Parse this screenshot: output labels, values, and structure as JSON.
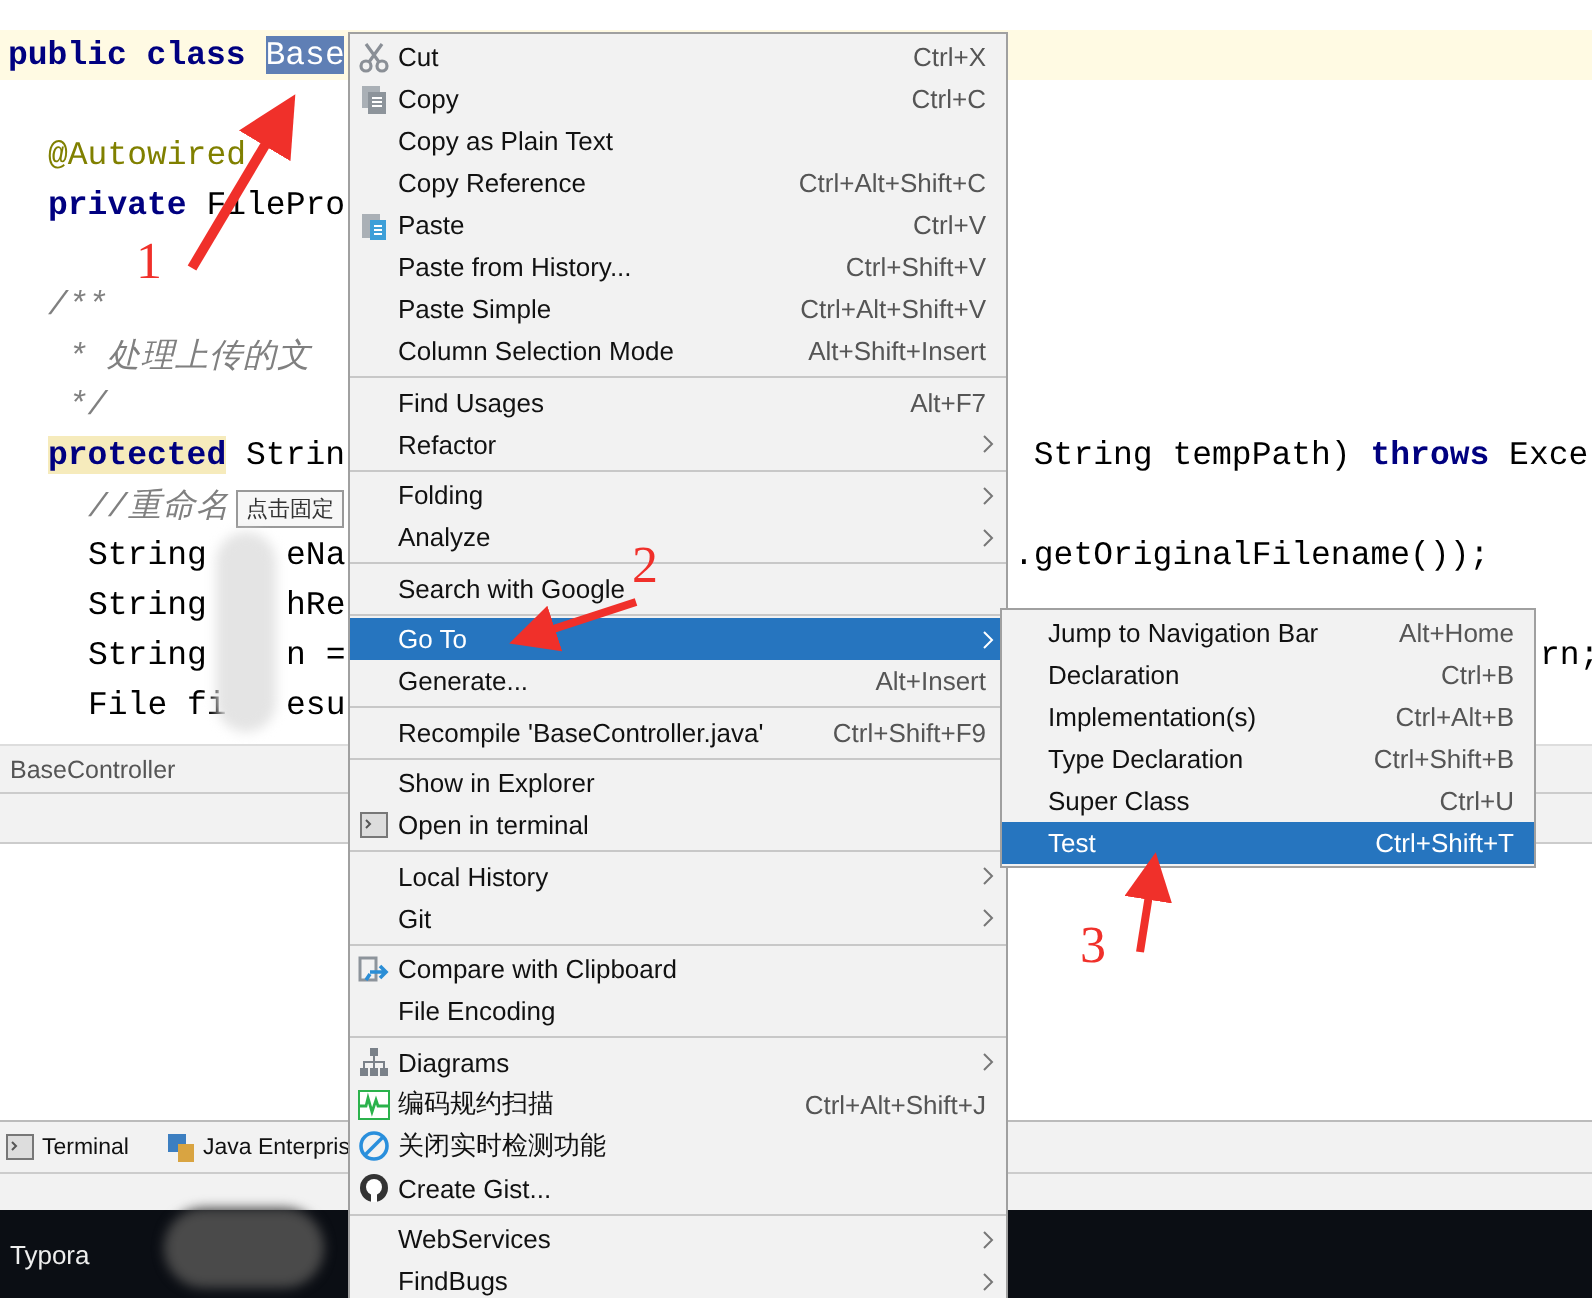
{
  "editor": {
    "lines": [
      {
        "kind": "top",
        "caret_row": true,
        "left": [
          {
            "text": "public class ",
            "kind": "keyword"
          },
          {
            "text": "Base",
            "kind": "selected"
          }
        ]
      },
      {
        "kind": "member"
      },
      {
        "kind": "member",
        "left": [
          {
            "text": "@Autowired",
            "kind": "annotation"
          }
        ]
      },
      {
        "kind": "member",
        "left": [
          {
            "text": "private ",
            "kind": "keyword"
          },
          {
            "text": "FilePro",
            "kind": "plain"
          }
        ]
      },
      {
        "kind": "member"
      },
      {
        "kind": "member",
        "left": [
          {
            "text": "/**",
            "kind": "comment"
          }
        ]
      },
      {
        "kind": "member",
        "left": [
          {
            "text": " * 处理上传的文",
            "kind": "comment"
          }
        ]
      },
      {
        "kind": "member",
        "left": [
          {
            "text": " */",
            "kind": "comment"
          }
        ]
      },
      {
        "kind": "member",
        "left": [
          {
            "text": "protected",
            "kind": "marked"
          },
          {
            "text": " Strin",
            "kind": "plain"
          }
        ],
        "right": [
          {
            "text": " String tempPath) ",
            "kind": "plain"
          },
          {
            "text": "throws",
            "kind": "keyword"
          },
          {
            "text": " Exce",
            "kind": "plain"
          }
        ]
      },
      {
        "kind": "body",
        "left": [
          {
            "text": "//重命名",
            "kind": "comment"
          }
        ]
      },
      {
        "kind": "body",
        "left": [
          {
            "text": "String    eNa",
            "kind": "plain"
          }
        ],
        "right": [
          {
            "text": ".getOriginalFilename());",
            "kind": "plain"
          }
        ]
      },
      {
        "kind": "body",
        "left": [
          {
            "text": "String    hRe",
            "kind": "plain"
          }
        ]
      },
      {
        "kind": "body",
        "left": [
          {
            "text": "String    n =",
            "kind": "plain"
          }
        ],
        "right": [
          {
            "text": "rn;",
            "kind": "tail"
          }
        ]
      },
      {
        "kind": "body",
        "left": [
          {
            "text": "File fi   esu",
            "kind": "plain"
          }
        ]
      }
    ],
    "tooltip": "点击固定"
  },
  "tab": {
    "label": "BaseController"
  },
  "tool_windows": [
    {
      "label": "Terminal",
      "kind": "terminal"
    },
    {
      "label": "Java Enterpris",
      "kind": "enterprise"
    }
  ],
  "taskbar": {
    "label": "Typora"
  },
  "context_menu": [
    {
      "kind": "item",
      "label": "Cut",
      "shortcut": "Ctrl+X",
      "submenu": false,
      "selected": false
    },
    {
      "kind": "item",
      "label": "Copy",
      "shortcut": "Ctrl+C",
      "submenu": false,
      "selected": false
    },
    {
      "kind": "item",
      "label": "Copy as Plain Text",
      "submenu": false,
      "selected": false
    },
    {
      "kind": "item",
      "label": "Copy Reference",
      "shortcut": "Ctrl+Alt+Shift+C",
      "submenu": false,
      "selected": false
    },
    {
      "kind": "item",
      "label": "Paste",
      "shortcut": "Ctrl+V",
      "submenu": false,
      "selected": false
    },
    {
      "kind": "item",
      "label": "Paste from History...",
      "shortcut": "Ctrl+Shift+V",
      "submenu": false,
      "selected": false
    },
    {
      "kind": "item",
      "label": "Paste Simple",
      "shortcut": "Ctrl+Alt+Shift+V",
      "submenu": false,
      "selected": false
    },
    {
      "kind": "item",
      "label": "Column Selection Mode",
      "shortcut": "Alt+Shift+Insert",
      "submenu": false,
      "selected": false
    },
    {
      "kind": "separator"
    },
    {
      "kind": "item",
      "label": "Find Usages",
      "shortcut": "Alt+F7",
      "submenu": false,
      "selected": false
    },
    {
      "kind": "item",
      "label": "Refactor",
      "submenu": true,
      "selected": false
    },
    {
      "kind": "separator"
    },
    {
      "kind": "item",
      "label": "Folding",
      "submenu": true,
      "selected": false
    },
    {
      "kind": "item",
      "label": "Analyze",
      "submenu": true,
      "selected": false
    },
    {
      "kind": "separator"
    },
    {
      "kind": "item",
      "label": "Search with Google",
      "submenu": false,
      "selected": false
    },
    {
      "kind": "separator"
    },
    {
      "kind": "item",
      "label": "Go To",
      "submenu": true,
      "selected": true
    },
    {
      "kind": "item",
      "label": "Generate...",
      "shortcut": "Alt+Insert",
      "submenu": false,
      "selected": false
    },
    {
      "kind": "separator"
    },
    {
      "kind": "item",
      "label": "Recompile 'BaseController.java'",
      "shortcut": "Ctrl+Shift+F9",
      "submenu": false,
      "selected": false
    },
    {
      "kind": "separator"
    },
    {
      "kind": "item",
      "label": "Show in Explorer",
      "submenu": false,
      "selected": false
    },
    {
      "kind": "item",
      "label": "Open in terminal",
      "submenu": false,
      "selected": false
    },
    {
      "kind": "separator"
    },
    {
      "kind": "item",
      "label": "Local History",
      "submenu": true,
      "selected": false
    },
    {
      "kind": "item",
      "label": "Git",
      "submenu": true,
      "selected": false
    },
    {
      "kind": "separator"
    },
    {
      "kind": "item",
      "label": "Compare with Clipboard",
      "submenu": false,
      "selected": false
    },
    {
      "kind": "item",
      "label": "File Encoding",
      "submenu": false,
      "selected": false
    },
    {
      "kind": "separator"
    },
    {
      "kind": "item",
      "label": "Diagrams",
      "submenu": true,
      "selected": false
    },
    {
      "kind": "item",
      "label": "编码规约扫描",
      "shortcut": "Ctrl+Alt+Shift+J",
      "submenu": false,
      "selected": false
    },
    {
      "kind": "item",
      "label": "关闭实时检测功能",
      "submenu": false,
      "selected": false
    },
    {
      "kind": "item",
      "label": "Create Gist...",
      "submenu": false,
      "selected": false
    },
    {
      "kind": "separator"
    },
    {
      "kind": "item",
      "label": "WebServices",
      "submenu": true,
      "selected": false
    },
    {
      "kind": "item",
      "label": "FindBugs",
      "submenu": true,
      "selected": false
    }
  ],
  "submenu": [
    {
      "label": "Jump to Navigation Bar",
      "shortcut": "Alt+Home",
      "selected": false
    },
    {
      "label": "Declaration",
      "shortcut": "Ctrl+B",
      "selected": false
    },
    {
      "label": "Implementation(s)",
      "shortcut": "Ctrl+Alt+B",
      "selected": false
    },
    {
      "label": "Type Declaration",
      "shortcut": "Ctrl+Shift+B",
      "selected": false
    },
    {
      "label": "Super Class",
      "shortcut": "Ctrl+U",
      "selected": false
    },
    {
      "label": "Test",
      "shortcut": "Ctrl+Shift+T",
      "selected": true
    }
  ],
  "annotations": [
    {
      "label": "1",
      "kind": "one"
    },
    {
      "label": "2",
      "kind": "two"
    },
    {
      "label": "3",
      "kind": "three"
    }
  ]
}
